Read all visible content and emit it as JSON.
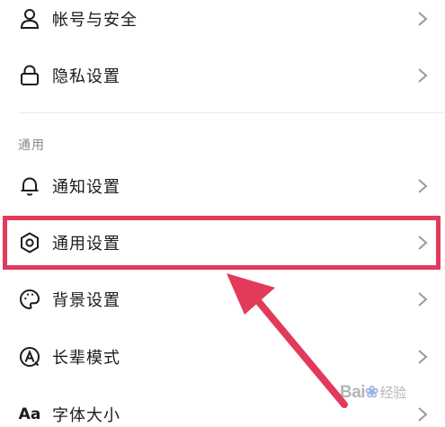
{
  "settings": {
    "items": [
      {
        "label": "帐号与安全",
        "icon": "person-icon"
      },
      {
        "label": "隐私设置",
        "icon": "lock-icon"
      }
    ],
    "general_section": {
      "header": "通用",
      "items": [
        {
          "label": "通知设置",
          "icon": "bell-icon"
        },
        {
          "label": "通用设置",
          "icon": "gear-icon"
        },
        {
          "label": "背景设置",
          "icon": "palette-icon"
        },
        {
          "label": "长辈模式",
          "icon": "elder-mode-icon"
        },
        {
          "label": "字体大小",
          "icon": "font-size-icon",
          "icon_text": "Aa"
        }
      ]
    }
  },
  "annotation": {
    "highlighted_item": "通用设置",
    "highlight_color": "#e23a5a",
    "arrow_color": "#e23a5a"
  },
  "watermark": {
    "brand": "Bai",
    "brand_suffix": "经验",
    "color": "#888888"
  }
}
